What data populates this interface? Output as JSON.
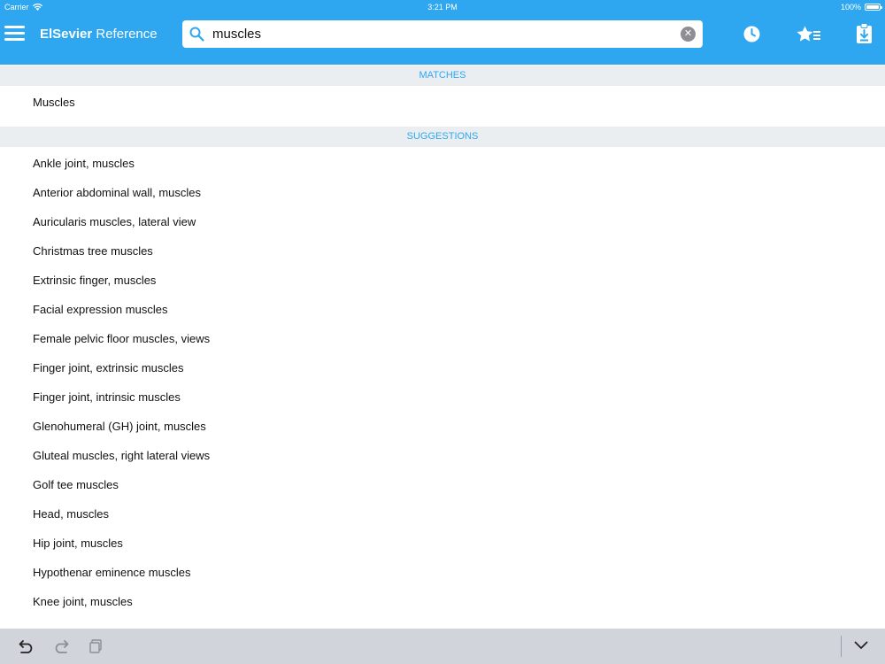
{
  "status_bar": {
    "carrier": "Carrier",
    "time": "3:21 PM",
    "battery_text": "100%",
    "battery_level": 1.0
  },
  "header": {
    "brand_bold": "ElSevier",
    "brand_light": " Reference",
    "menu_icon": "hamburger-menu-icon",
    "search": {
      "value": "muscles",
      "icon": "search-icon",
      "clear_icon": "clear-circle-icon"
    },
    "actions": [
      {
        "name": "history",
        "icon": "clock-icon"
      },
      {
        "name": "favorites",
        "icon": "star-list-icon"
      },
      {
        "name": "downloads",
        "icon": "clipboard-download-icon"
      }
    ]
  },
  "matches": {
    "header": "MATCHES",
    "items": [
      "Muscles"
    ]
  },
  "suggestions": {
    "header": "SUGGESTIONS",
    "items": [
      "Ankle joint, muscles",
      "Anterior abdominal wall, muscles",
      "Auricularis muscles, lateral view",
      "Christmas tree muscles",
      "Extrinsic finger, muscles",
      "Facial expression muscles",
      "Female pelvic floor muscles, views",
      "Finger joint, extrinsic muscles",
      "Finger joint, intrinsic muscles",
      "Glenohumeral (GH) joint, muscles",
      "Gluteal muscles, right lateral views",
      "Golf tee muscles",
      "Head, muscles",
      "Hip joint, muscles",
      "Hypothenar eminence muscles",
      "Knee joint, muscles"
    ]
  },
  "bottom_bar": {
    "icons": [
      "undo-icon",
      "redo-icon",
      "paste-icon",
      "chevron-down-icon"
    ]
  },
  "colors": {
    "accent": "#2fa7f0",
    "section_bg": "#ebeef1",
    "toolbar_bg": "#d1d5db"
  }
}
